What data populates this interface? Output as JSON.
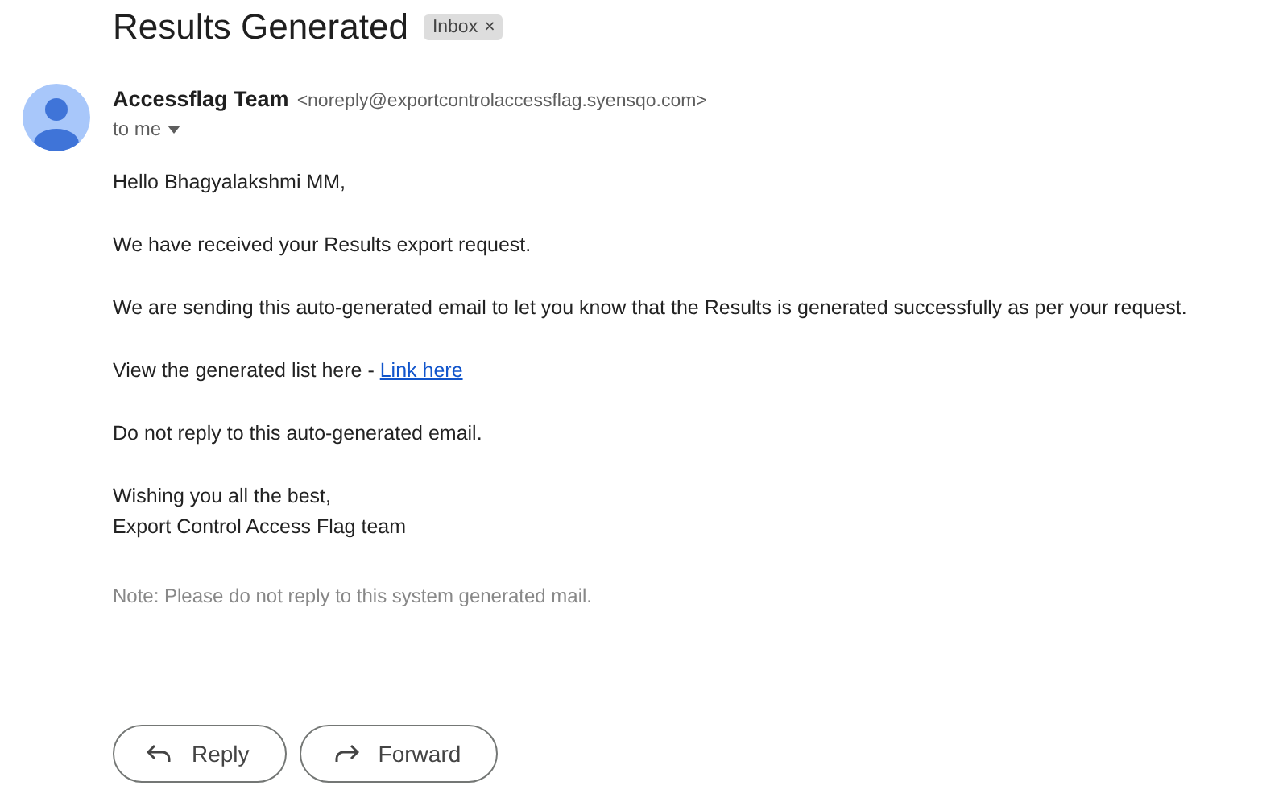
{
  "subject": "Results Generated",
  "label": {
    "text": "Inbox",
    "close": "×"
  },
  "sender": {
    "name": "Accessflag Team",
    "email": "<noreply@exportcontrolaccessflag.syensqo.com>",
    "recipient": "to me"
  },
  "body": [
    {
      "kind": "text",
      "text": "Hello Bhagyalakshmi MM,"
    },
    {
      "kind": "text",
      "text": "We have received your Results export request."
    },
    {
      "kind": "text",
      "text": "We are sending this auto-generated email to let you know that the Results is generated successfully as per your request."
    },
    {
      "kind": "link",
      "text": "View the generated list here - ",
      "link": "Link here"
    },
    {
      "kind": "text",
      "text": "Do not reply to this auto-generated email."
    },
    {
      "kind": "signature",
      "lines": [
        "Wishing you all the best,",
        "Export Control Access Flag team"
      ]
    },
    {
      "kind": "note",
      "text": "Note: Please do not reply to this system generated mail."
    }
  ],
  "actions": [
    {
      "kind": "reply",
      "label": "Reply"
    },
    {
      "kind": "forward",
      "label": "Forward"
    }
  ]
}
